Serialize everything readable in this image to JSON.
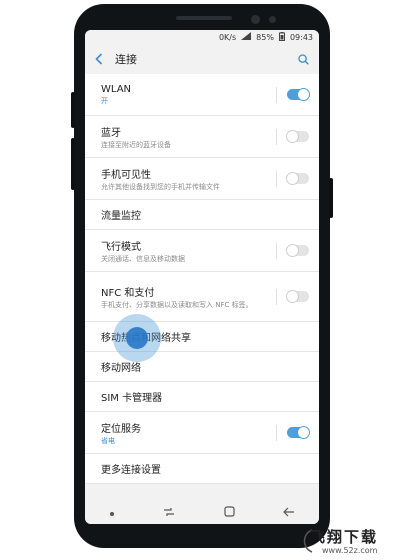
{
  "status_bar": {
    "speed": "0K/s",
    "battery": "85%",
    "time": "09:43"
  },
  "header": {
    "title": "连接"
  },
  "items": [
    {
      "title": "WLAN",
      "subtitle": "开",
      "toggle": "on"
    },
    {
      "title": "蓝牙",
      "subtitle": "连接至附近的蓝牙设备",
      "toggle": "off"
    },
    {
      "title": "手机可见性",
      "subtitle": "允许其他设备找到您的手机并传输文件",
      "toggle": "off"
    },
    {
      "title": "流量监控"
    },
    {
      "title": "飞行模式",
      "subtitle": "关闭通话、信息及移动数据",
      "toggle": "off"
    },
    {
      "title": "NFC 和支付",
      "subtitle": "手机支付、分享数据以及读取和写入 NFC 标签。",
      "toggle": "off"
    },
    {
      "title": "移动热点和网络共享"
    },
    {
      "title": "移动网络"
    },
    {
      "title": "SIM 卡管理器"
    },
    {
      "title": "定位服务",
      "subtitle": "省电",
      "toggle": "on"
    },
    {
      "title": "更多连接设置"
    }
  ],
  "watermark": {
    "name": "飞翔下载",
    "url": "www.52z.com"
  },
  "colors": {
    "accent": "#4a9fdc",
    "tap": "#2878c8"
  }
}
